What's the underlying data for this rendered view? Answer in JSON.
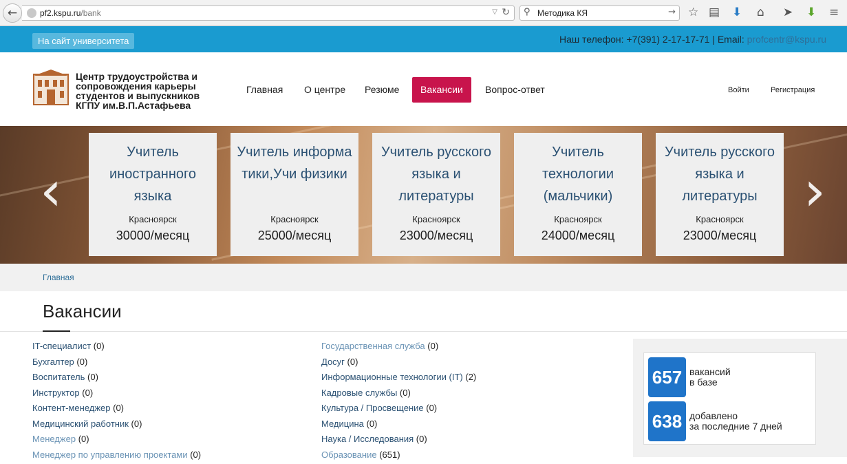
{
  "browser": {
    "url_host": "pf2.kspu.ru",
    "url_path": "/bank",
    "search_value": "Методика КЯ"
  },
  "topbar": {
    "univ_button": "На сайт университета",
    "phone_text": "Наш телефон: +7(391) 2-17-17-71 | Email: ",
    "email": "profcentr@kspu.ru"
  },
  "header": {
    "logo_text": "Центр трудоустройства и сопровождения карьеры студентов и выпускников КГПУ им.В.П.Астафьева",
    "nav": [
      "Главная",
      "О центре",
      "Резюме",
      "Вакансии",
      "Вопрос-ответ"
    ],
    "active_nav": "Вакансии",
    "login": "Войти",
    "register": "Регистрация"
  },
  "slider": {
    "cards": [
      {
        "title": "Учитель иностранного языка",
        "city": "Красноярск",
        "salary": "30000/месяц"
      },
      {
        "title": "Учитель информатики,Учи физики",
        "city": "Красноярск",
        "salary": "25000/месяц"
      },
      {
        "title": "Учитель русского языка и литературы",
        "city": "Красноярск",
        "salary": "23000/месяц"
      },
      {
        "title": "Учитель технологии (мальчики)",
        "city": "Красноярск",
        "salary": "24000/месяц"
      },
      {
        "title": "Учитель русского языка и литературы",
        "city": "Красноярск",
        "salary": "23000/месяц"
      }
    ]
  },
  "breadcrumb": "Главная",
  "page_title": "Вакансии",
  "categories_left": [
    {
      "name": "IT-специалист",
      "count": " (0)"
    },
    {
      "name": "Бухгалтер",
      "count": " (0)"
    },
    {
      "name": "Воспитатель",
      "count": " (0)"
    },
    {
      "name": "Инструктор",
      "count": " (0)"
    },
    {
      "name": "Контент-менеджер",
      "count": " (0)"
    },
    {
      "name": "Медицинский работник",
      "count": " (0)"
    },
    {
      "name": "Менеджер",
      "count": " (0)"
    },
    {
      "name": "Менеджер по управлению проектами",
      "count": " (0)"
    }
  ],
  "categories_right": [
    {
      "name": "Государственная служба",
      "count": " (0)"
    },
    {
      "name": "Досуг",
      "count": " (0)"
    },
    {
      "name": "Информационные технологии (IT)",
      "count": " (2)"
    },
    {
      "name": "Кадровые службы",
      "count": " (0)"
    },
    {
      "name": "Культура / Просвещение",
      "count": " (0)"
    },
    {
      "name": "Медицина",
      "count": " (0)"
    },
    {
      "name": "Наука / Исследования",
      "count": " (0)"
    },
    {
      "name": "Образование",
      "count": " (651)"
    }
  ],
  "stats": {
    "total_value": "657",
    "total_label1": "вакансий",
    "total_label2": "в базе",
    "week_value": "638",
    "week_label1": "добавлено",
    "week_label2": "за последние 7 дней"
  },
  "colors": {
    "topbar": "#1a9bd0",
    "active_nav": "#c8144c",
    "stat_badge": "#1f74c9"
  }
}
